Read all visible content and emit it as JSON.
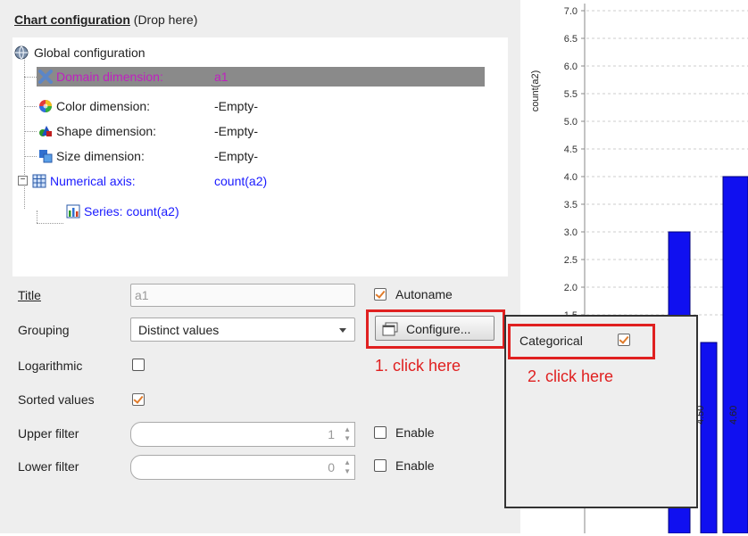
{
  "header": {
    "title_bold": "Chart configuration",
    "title_rest": " (Drop here)"
  },
  "tree": {
    "global": "Global configuration",
    "rows": [
      {
        "label": "Domain dimension:",
        "value": "a1"
      },
      {
        "label": "Color dimension:",
        "value": "-Empty-"
      },
      {
        "label": "Shape dimension:",
        "value": "-Empty-"
      },
      {
        "label": "Size dimension:",
        "value": "-Empty-"
      },
      {
        "label": "Numerical axis:",
        "value": "count(a2)"
      }
    ],
    "series": "Series: count(a2)"
  },
  "form": {
    "title_label": "Title",
    "title_value": "a1",
    "autoname_label": "Autoname",
    "grouping_label": "Grouping",
    "grouping_value": "Distinct values",
    "configure_label": "Configure...",
    "logarithmic_label": "Logarithmic",
    "sorted_label": "Sorted values",
    "upper_label": "Upper filter",
    "upper_value": "1",
    "lower_label": "Lower filter",
    "lower_value": "0",
    "enable_label": "Enable"
  },
  "annotations": {
    "step1": "1. click here",
    "step2": "2. click here"
  },
  "popup": {
    "categorical_label": "Categorical"
  },
  "chart_data": {
    "type": "bar",
    "ylabel": "count(a2)",
    "yticks": [
      "7.0",
      "6.5",
      "6.0",
      "5.5",
      "5.0",
      "4.5",
      "4.0",
      "3.5",
      "3.0",
      "2.5",
      "2.0",
      "1.5"
    ],
    "xticks": [
      "4.50",
      "4.60"
    ],
    "values": [
      3,
      1,
      4
    ],
    "bar_color": "#1010f0"
  }
}
